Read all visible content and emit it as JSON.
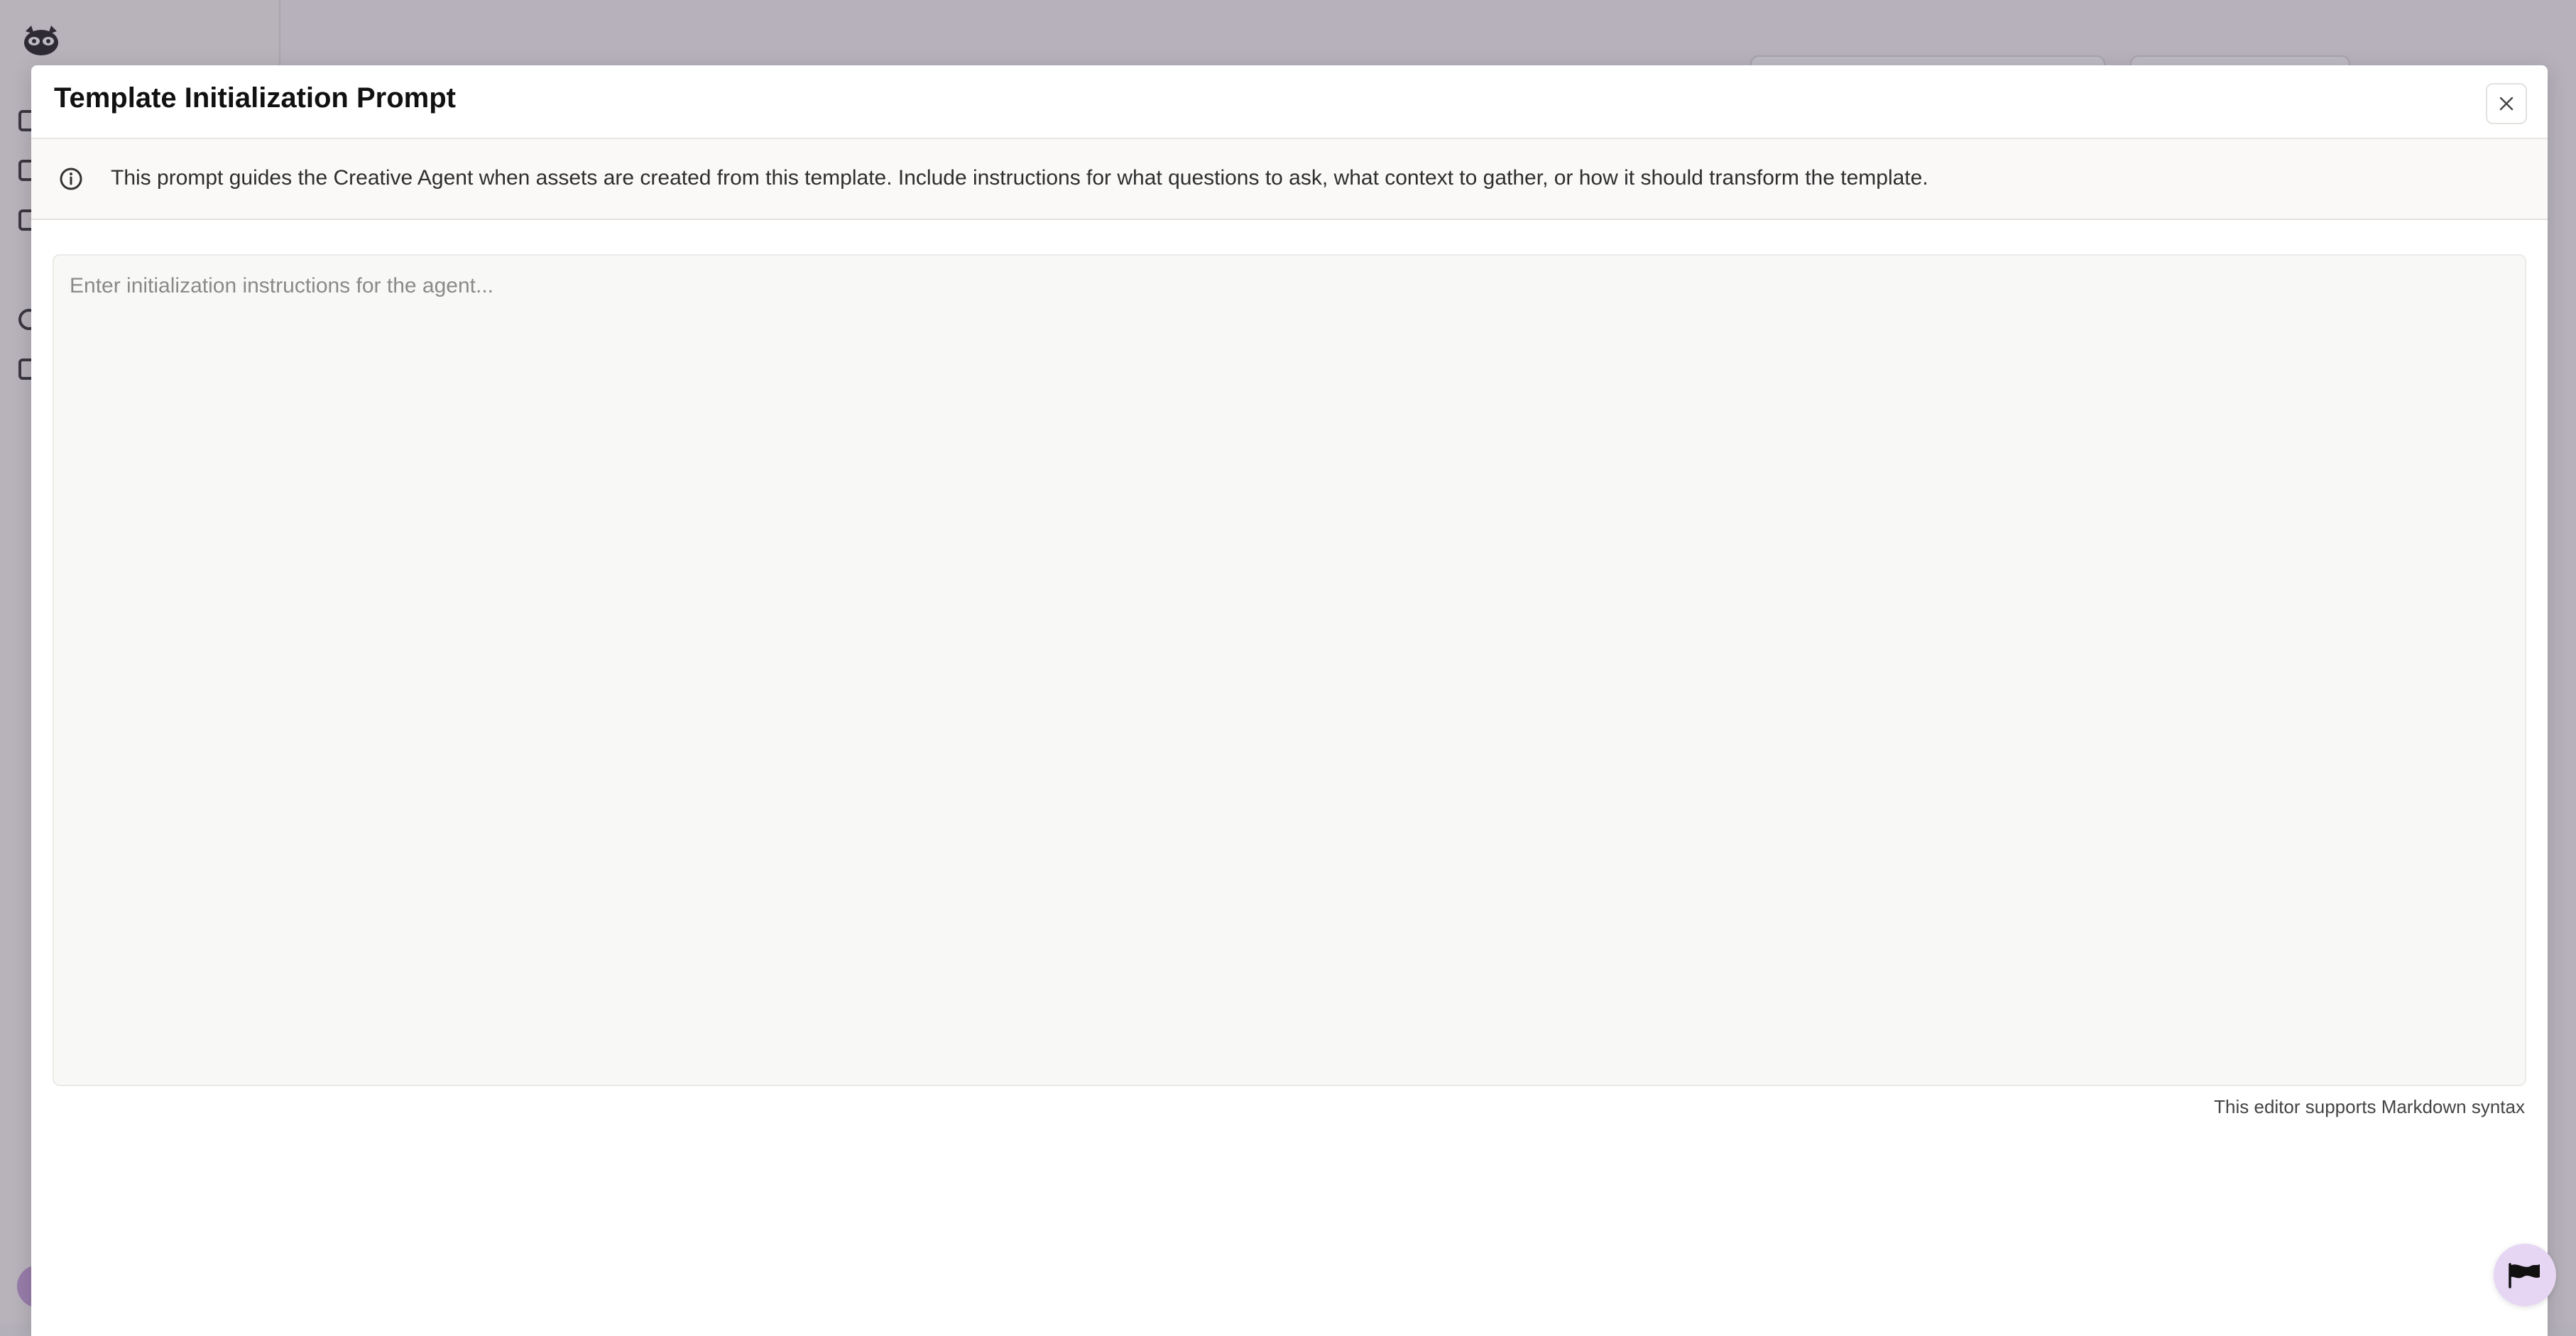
{
  "modal": {
    "title": "Template Initialization Prompt",
    "info_text": "This prompt guides the Creative Agent when assets are created from this template. Include instructions for what questions to ask, what context to gather, or how it should transform the template.",
    "editor": {
      "value": "",
      "placeholder": "Enter initialization instructions for the agent..."
    },
    "editor_hint": "This editor supports Markdown syntax"
  },
  "icons": {
    "close": "close-icon",
    "info": "info-icon",
    "feedback": "flag-icon",
    "logo": "raccoon-logo-icon"
  },
  "colors": {
    "overlay": "#b4b0b9",
    "modal_bg": "#ffffff",
    "editor_bg": "#f8f8f7",
    "fab_bg": "#e6d6f3"
  }
}
